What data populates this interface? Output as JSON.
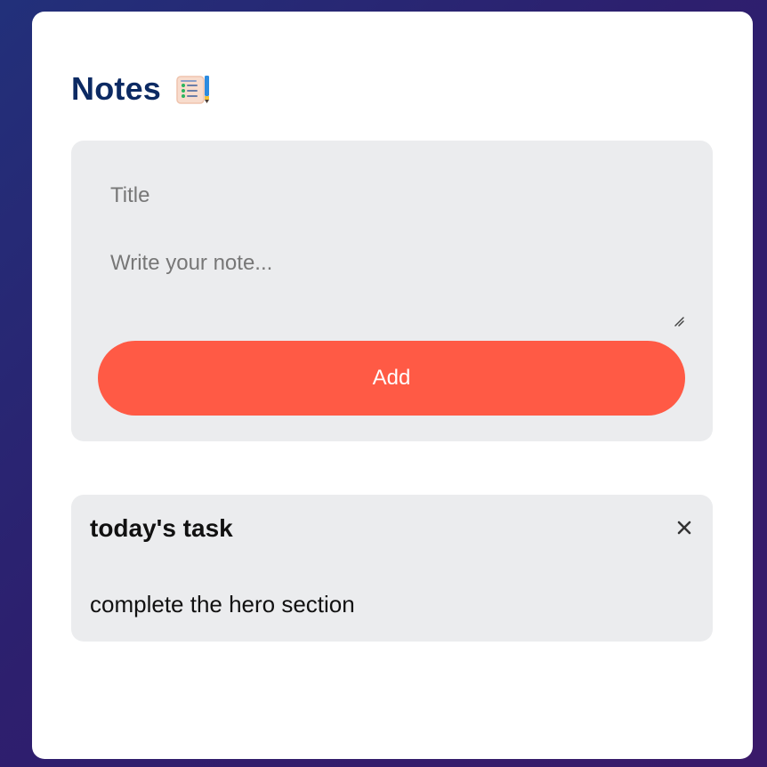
{
  "header": {
    "title": "Notes",
    "icon": "notepad-icon"
  },
  "form": {
    "title_placeholder": "Title",
    "title_value": "",
    "note_placeholder": "Write your note...",
    "note_value": "",
    "add_label": "Add"
  },
  "notes": [
    {
      "title": "today's task",
      "body": "complete the hero section",
      "close_icon": "close-icon"
    }
  ],
  "colors": {
    "background_start": "#22307a",
    "background_end": "#3a1a6a",
    "title": "#0c2a63",
    "panel": "#ebecee",
    "accent": "#ff5a45"
  }
}
